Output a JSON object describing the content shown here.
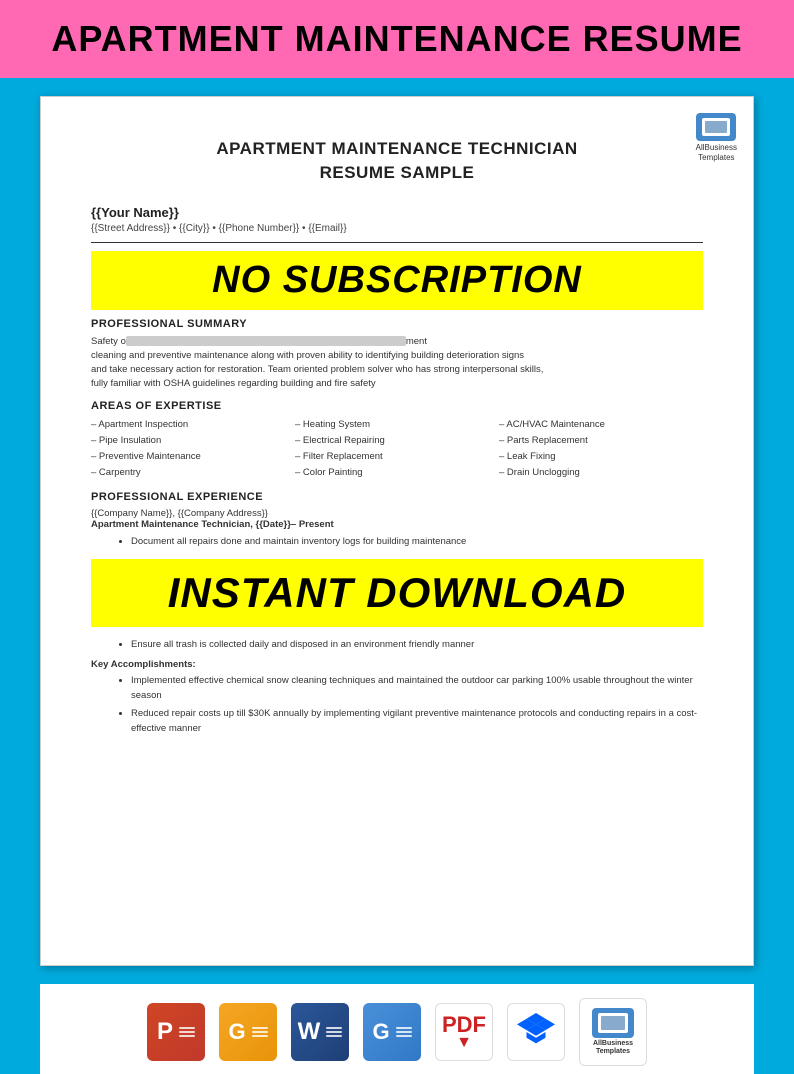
{
  "page": {
    "background_color": "#00AADD",
    "header": {
      "background": "#FF69B4",
      "title": "APARTMENT MAINTENANCE RESUME"
    },
    "document": {
      "title_line1": "APARTMENT MAINTENANCE TECHNICIAN",
      "title_line2": "RESUME SAMPLE",
      "logo": {
        "text_line1": "AllBusiness",
        "text_line2": "Templates"
      },
      "placeholder_name": "{{Your Name}}",
      "placeholder_address": "{{Street Address}} • {{City}} • {{Phone Number}} • {{Email}}",
      "no_subscription_label": "NO SUBSCRIPTION",
      "professional_summary_label": "PROFESSIONAL SUMMARY",
      "profile_text_visible": "Safety o... ...ment cleaning and preventive maintenance along with proven ability to identifying building deterioration signs and take necessary action for restoration. Team oriented problem solver who has strong interpersonal skills, fully familiar with OSHA guidelines regarding building and fire safety",
      "areas_of_expertise_label": "AREAS OF EXPERTISE",
      "expertise_col1": [
        "– Apartment Inspection",
        "– Pipe Insulation",
        "– Preventive Maintenance",
        "– Carpentry"
      ],
      "expertise_col2": [
        "– Heating System",
        "– Electrical Repairing",
        "– Filter Replacement",
        "– Color Painting"
      ],
      "expertise_col3": [
        "– AC/HVAC Maintenance",
        "– Parts Replacement",
        "– Leak Fixing",
        "– Drain Unclogging"
      ],
      "professional_experience_label": "PROFESSIONAL EXPERIENCE",
      "company_line": "{{Company Name}}, {{Company Address}}",
      "job_title_line": "Apartment Maintenance Technician, {{Date}}– Present",
      "bullet1": "Document all repairs done and maintain inventory logs for building maintenance",
      "instant_download_label": "INSTANT DOWNLOAD",
      "bullet2": "Ensure all trash is collected daily and disposed in an environment friendly manner",
      "key_accomplishments_label": "Key Accomplishments:",
      "accomplishment1": "Implemented effective chemical snow cleaning techniques and maintained the outdoor car parking 100% usable throughout the winter season",
      "accomplishment2": "Reduced repair costs up till $30K annually by implementing vigilant preventive maintenance protocols and conducting repairs in a cost-effective manner"
    },
    "footer_icons": [
      {
        "id": "powerpoint",
        "label": "P",
        "type": "powerpoint"
      },
      {
        "id": "slides",
        "label": "G",
        "type": "slides"
      },
      {
        "id": "word",
        "label": "W",
        "type": "word"
      },
      {
        "id": "docs",
        "label": "G",
        "type": "docs"
      },
      {
        "id": "pdf",
        "label": "PDF",
        "type": "pdf"
      },
      {
        "id": "dropbox",
        "label": "Dropbox",
        "type": "dropbox"
      },
      {
        "id": "allbusiness",
        "label": "AllBusiness Templates",
        "type": "allbiz"
      }
    ]
  }
}
